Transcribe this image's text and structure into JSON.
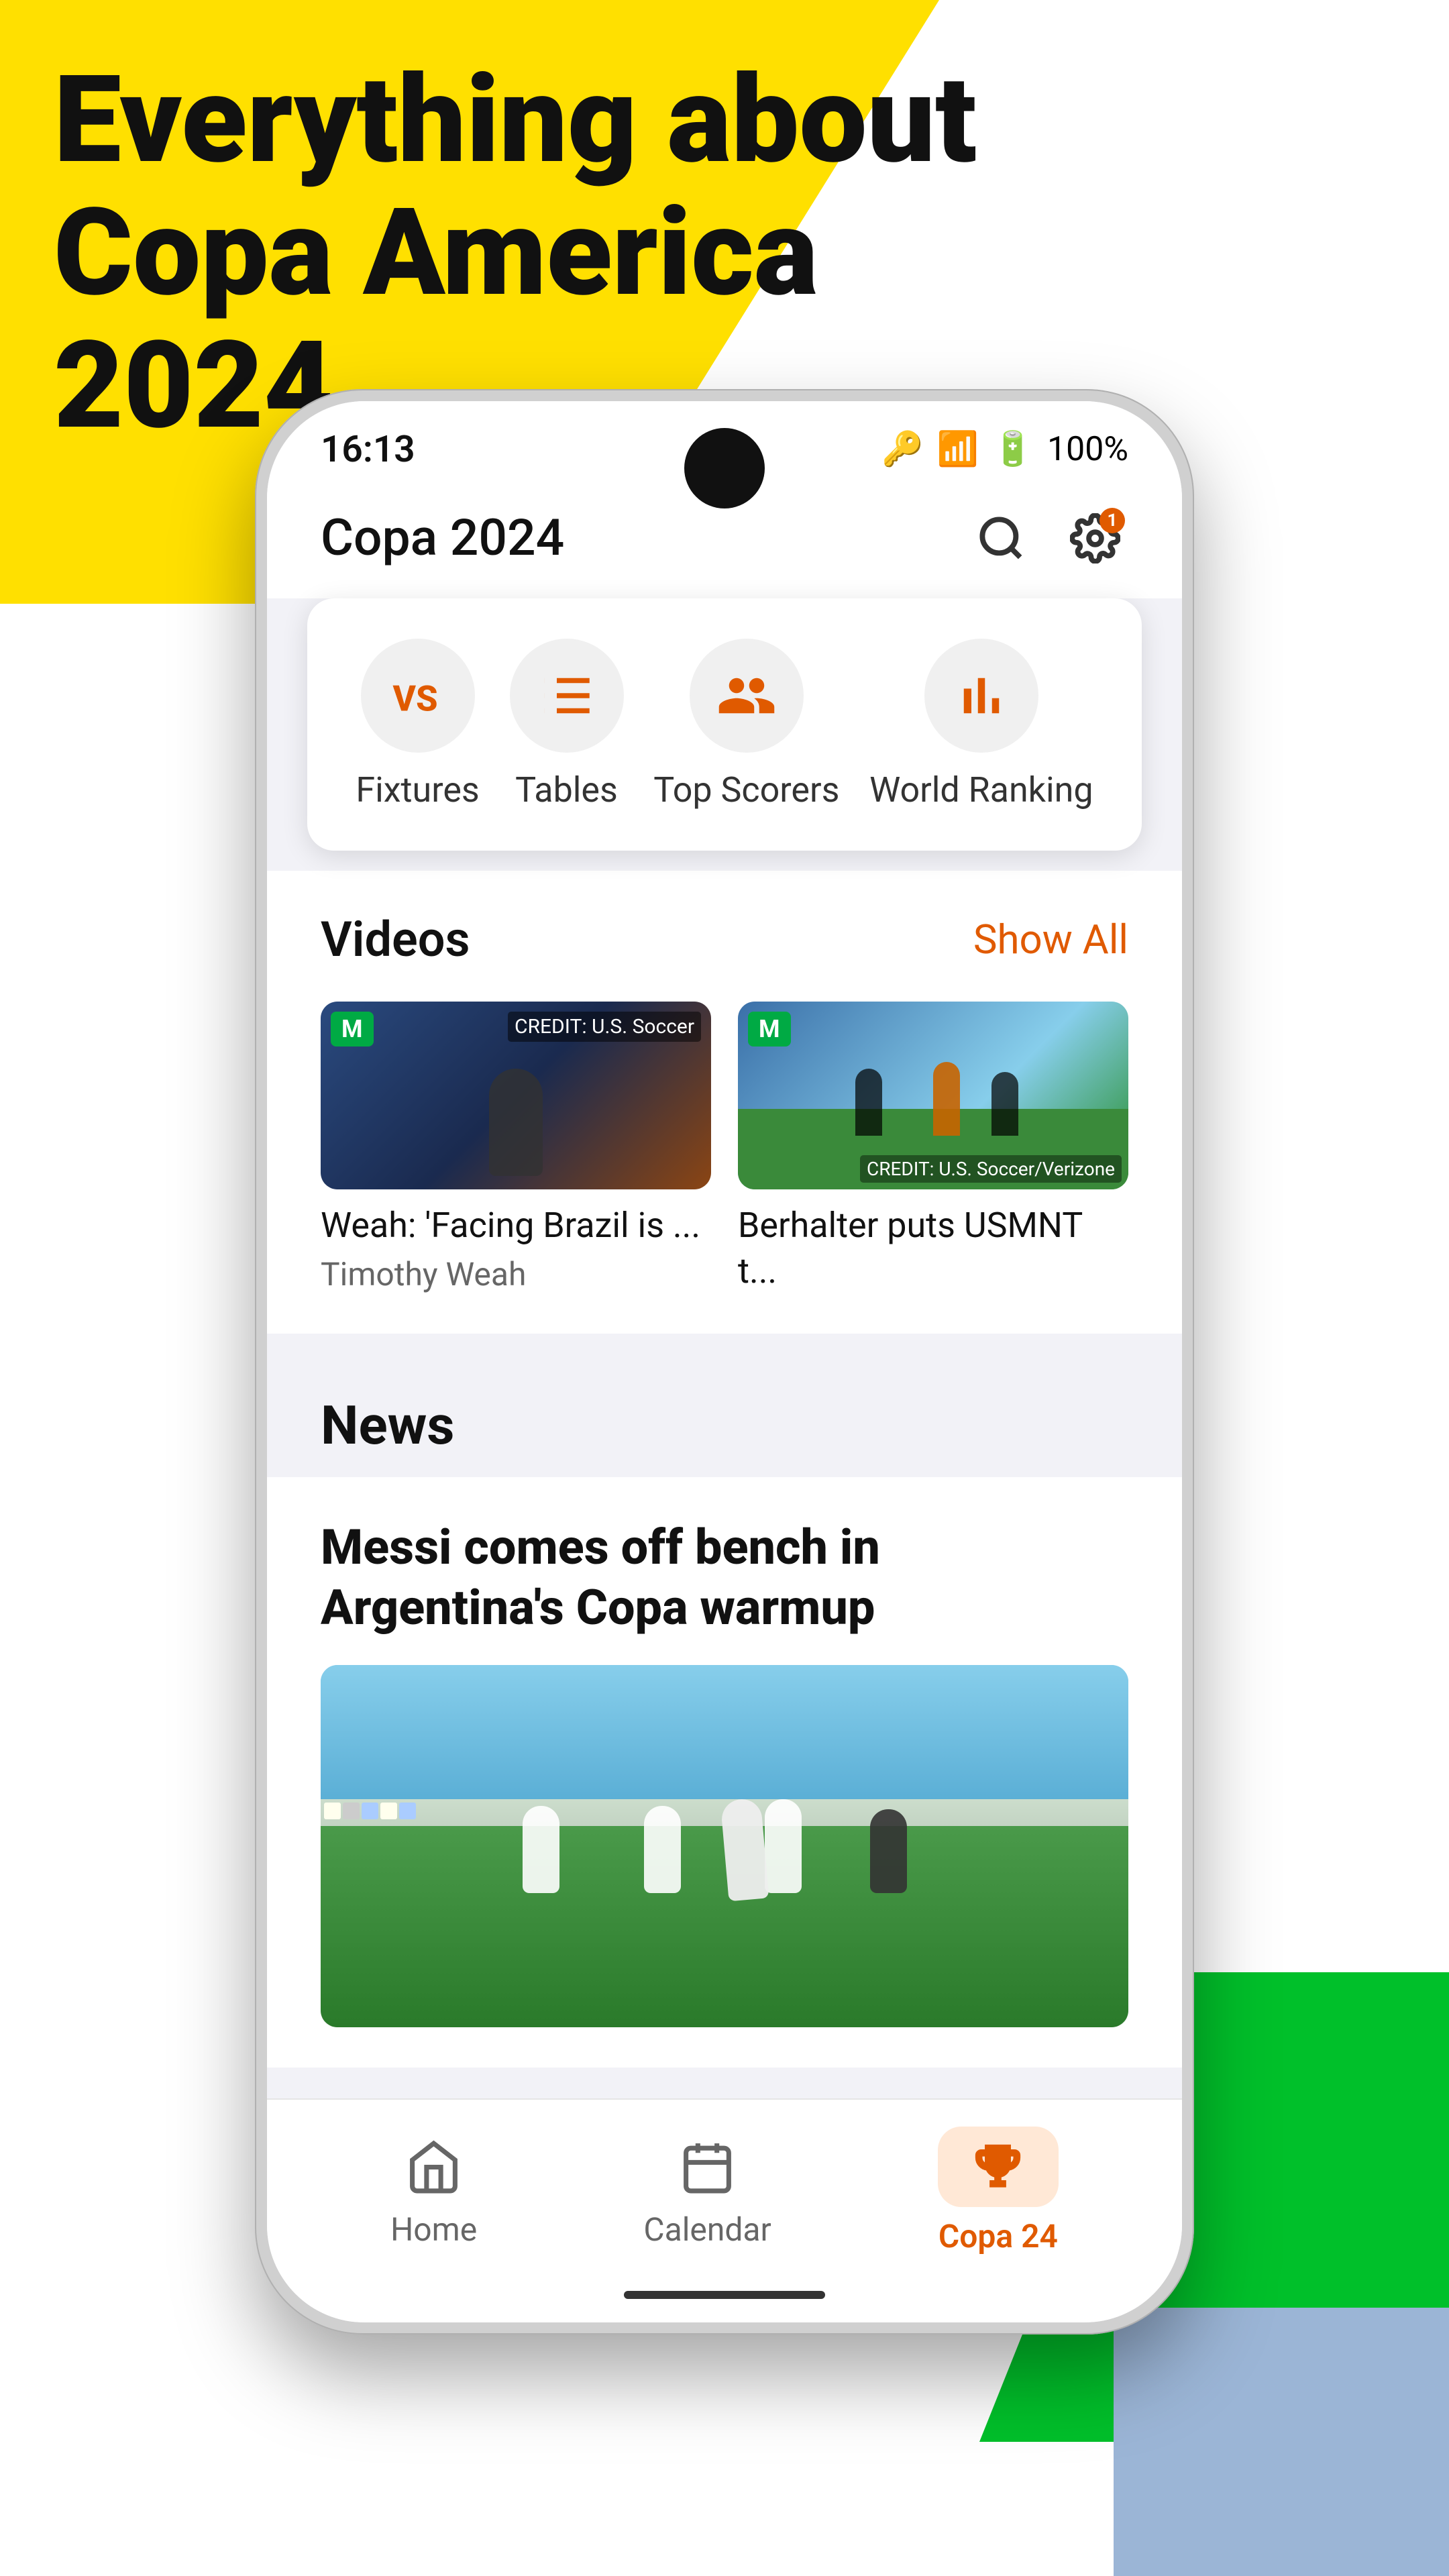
{
  "background": {
    "yellow_color": "#FFE000",
    "green_color": "#00C02A",
    "blue_color": "#9BB5D6"
  },
  "headline": {
    "line1": "Everything about",
    "line2": "Copa America 2024"
  },
  "status_bar": {
    "time": "16:13",
    "battery": "100%"
  },
  "app_header": {
    "title": "Copa 2024"
  },
  "notification_badge": "1",
  "nav_items": [
    {
      "id": "fixtures",
      "label": "Fixtures",
      "icon": "vs-icon"
    },
    {
      "id": "tables",
      "label": "Tables",
      "icon": "tables-icon"
    },
    {
      "id": "top-scorers",
      "label": "Top Scorers",
      "icon": "scorers-icon"
    },
    {
      "id": "world-ranking",
      "label": "World Ranking",
      "icon": "ranking-icon"
    }
  ],
  "videos_section": {
    "title": "Videos",
    "show_all_label": "Show All",
    "items": [
      {
        "title": "Weah: 'Facing Brazil is ...",
        "subtitle": "Timothy Weah",
        "badge": "M"
      },
      {
        "title": "Berhalter puts USMNT t...",
        "subtitle": "",
        "badge": "M",
        "credit": "CREDIT: U.S. Soccer/Verizone"
      }
    ]
  },
  "news_section": {
    "title": "News",
    "featured_article": {
      "headline": "Messi comes off bench in Argentina's Copa warmup"
    }
  },
  "bottom_nav": {
    "items": [
      {
        "id": "home",
        "label": "Home",
        "icon": "home-icon",
        "active": false
      },
      {
        "id": "calendar",
        "label": "Calendar",
        "icon": "calendar-icon",
        "active": false
      },
      {
        "id": "copa24",
        "label": "Copa 24",
        "icon": "trophy-icon",
        "active": true
      }
    ]
  }
}
